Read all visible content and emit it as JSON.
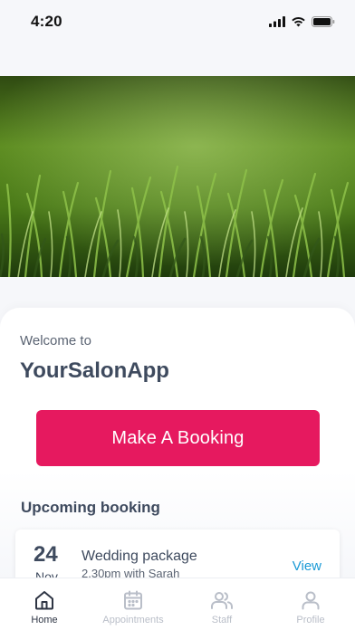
{
  "status_bar": {
    "time": "4:20",
    "icons": [
      "signal-icon",
      "wifi-icon",
      "battery-icon"
    ]
  },
  "hero": {
    "image": "grass-photo"
  },
  "welcome": {
    "prefix": "Welcome to",
    "app_name": "YourSalonApp"
  },
  "actions": {
    "booking_label": "Make A Booking",
    "booking_color": "#e6195f"
  },
  "upcoming": {
    "title": "Upcoming booking",
    "items": [
      {
        "day": "24",
        "month": "Nov",
        "title": "Wedding package",
        "detail": "2.30pm with Sarah",
        "action": "View"
      }
    ]
  },
  "tab_bar": {
    "tabs": [
      {
        "label": "Home",
        "icon": "home-icon",
        "active": true
      },
      {
        "label": "Appointments",
        "icon": "calendar-icon",
        "active": false
      },
      {
        "label": "Staff",
        "icon": "people-icon",
        "active": false
      },
      {
        "label": "Profile",
        "icon": "person-icon",
        "active": false
      }
    ]
  },
  "colors": {
    "accent": "#e6195f",
    "link": "#1a9ad6",
    "heading": "#3e4a5e"
  }
}
